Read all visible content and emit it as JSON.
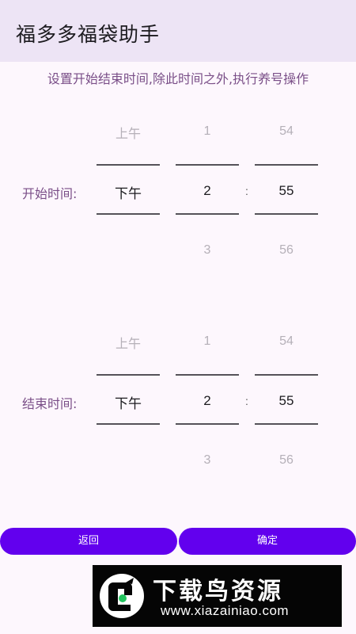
{
  "app_bar": {
    "title": "福多多福袋助手"
  },
  "hint": "设置开始结束时间,除此时间之外,执行养号操作",
  "start_picker": {
    "label": "开始时间:",
    "ampm": {
      "above": "上午",
      "selected": "下午"
    },
    "hour": {
      "above": "1",
      "selected": "2",
      "below": "3"
    },
    "separator": ":",
    "minute": {
      "above": "54",
      "selected": "55",
      "below": "56"
    }
  },
  "end_picker": {
    "label": "结束时间:",
    "ampm": {
      "above": "上午",
      "selected": "下午"
    },
    "hour": {
      "above": "1",
      "selected": "2",
      "below": "3"
    },
    "separator": ":",
    "minute": {
      "above": "54",
      "selected": "55",
      "below": "56"
    }
  },
  "buttons": {
    "back": "返回",
    "confirm": "确定"
  },
  "watermark": {
    "name": "下载鸟资源",
    "url": "www.xiazainiao.com"
  },
  "colors": {
    "accent": "#6200ee",
    "app_bar": "#ede4f5",
    "label": "#7a4f88",
    "background": "#fdf7fd"
  }
}
